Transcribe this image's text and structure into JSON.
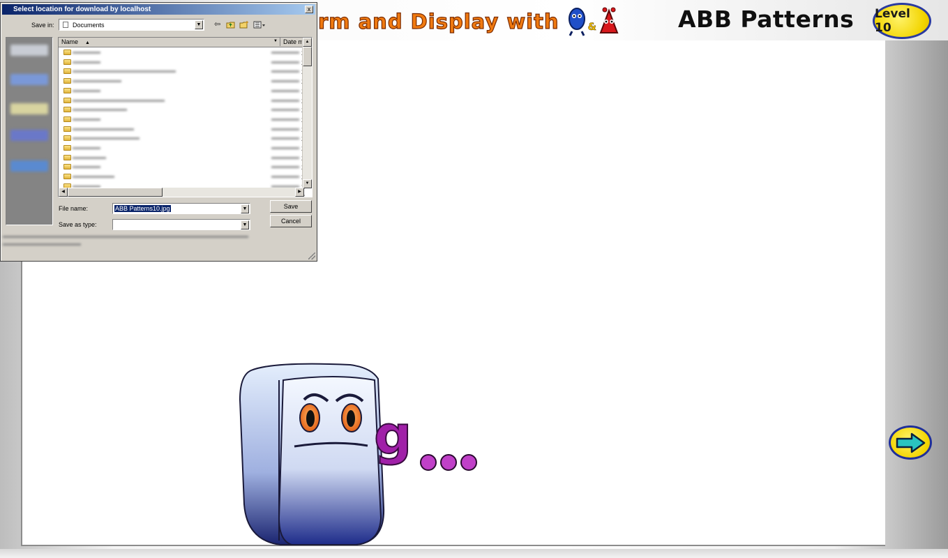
{
  "app": {
    "banner_text": "rm and Display with",
    "banner_amp": "&",
    "title": "ABB Patterns",
    "level_label": "Level 10",
    "next_arrow": "right-arrow-icon"
  },
  "stage": {
    "letter": "g",
    "letter_color": "#a020a8"
  },
  "dialog": {
    "title": "Select location for download by localhost",
    "close_label": "x",
    "save_in_label": "Save in:",
    "save_in_value": "Documents",
    "columns": {
      "name": "Name",
      "date": "Date m"
    },
    "file_name_label": "File name:",
    "file_name_value": "ABB Patterns10.jpg",
    "save_as_type_label": "Save as type:",
    "save_as_type_value": "",
    "save_button": "Save",
    "cancel_button": "Cancel",
    "date_char": "2"
  }
}
